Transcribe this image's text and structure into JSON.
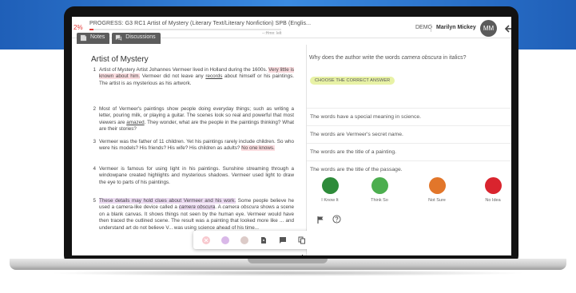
{
  "progress": {
    "percent_label": "2%",
    "fraction": 0.02,
    "prefix": "PROGRESS:",
    "title": "G3 RC1 Artist of Mystery (Literary Text/Literary Nonfiction) SPB (Englis...",
    "timer": "--:Hmn: lelt"
  },
  "tabs": [
    {
      "label": "Notes",
      "icon": "note-icon"
    },
    {
      "label": "Discussions",
      "icon": "discussion-icon"
    }
  ],
  "header": {
    "demo": "DEMO",
    "user_name": "Marilyn Mickey",
    "avatar_initials": "MM"
  },
  "passage": {
    "title": "Artist of Mystery",
    "paragraphs": [
      {
        "num": "1",
        "segments": [
          {
            "t": "Artist of Mystery Artist Johannes Vermeer lived in Holland during the 1600s. "
          },
          {
            "t": "Very little is known about him.",
            "style": "hl-r"
          },
          {
            "t": " Vermeer did not leave any "
          },
          {
            "t": "records",
            "style": "ul"
          },
          {
            "t": " about himself or his paintings. The artist is as mysterious as his artwork."
          }
        ]
      },
      {
        "num": "2",
        "segments": [
          {
            "t": "Most of Vermeer's paintings show people doing everyday things; such as writing a letter, pouring milk, or playing a guitar. The scenes look so real and powerful that most viewers are "
          },
          {
            "t": "amazed",
            "style": "ul"
          },
          {
            "t": ". They wonder, what are the people in the paintings thinking? What are their stories?"
          }
        ]
      },
      {
        "num": "3",
        "segments": [
          {
            "t": "Vermeer was the father of 11 children. Yet his paintings rarely include children. So who were his models? His friends? His wife? His children as adults? "
          },
          {
            "t": "No one knows.",
            "style": "hl-r"
          }
        ]
      },
      {
        "num": "4",
        "segments": [
          {
            "t": "Vermeer is famous for using light in his paintings. Sunshine streaming through a windowpane created highlights and mysterious shadows. Vermeer used light to draw the eye to parts of his paintings."
          }
        ]
      },
      {
        "num": "5",
        "segments": [
          {
            "t": "These details may hold clues about Vermeer and his work.",
            "style": "hl-p"
          },
          {
            "t": " Some people believe he used a camera-like device called a "
          },
          {
            "t": "camera obscura",
            "style": "hl-p it"
          },
          {
            "t": ". A "
          },
          {
            "t": "camera obscura",
            "style": "it"
          },
          {
            "t": " shows a scene on a blank canvas. It shows things not seen by the human eye. Vermeer would have then traced the outlined scene. The result was a painting that looked more like ... and understand art do not believe V... was using science ahead of his time..."
          }
        ]
      }
    ]
  },
  "highlight_toolbar": {
    "colors": [
      "#f8c9cf",
      "#d9b8e8",
      "#dccbc8"
    ],
    "icons": [
      "add-note-icon",
      "comment-icon",
      "copy-icon"
    ]
  },
  "question": {
    "stem_before": "Why does the author write the words ",
    "stem_italic": "camera obscura",
    "stem_after": " in italics?",
    "instruction": "CHOOSE THE CORRECT ANSWER",
    "options": [
      "The words have a special meaning in science.",
      "The words are Vermeer's secret name.",
      "The words are the title of a painting.",
      "The words are the title of the passage."
    ],
    "confidence": [
      {
        "label": "I Know It",
        "color": "#2e8b3a"
      },
      {
        "label": "Think So",
        "color": "#4cae4f"
      },
      {
        "label": "Not Sure",
        "color": "#e2762a"
      },
      {
        "label": "No Idea",
        "color": "#d9242e"
      }
    ]
  },
  "colors": {
    "accent_red": "#e53935",
    "background_blue": "#2a72cc"
  }
}
